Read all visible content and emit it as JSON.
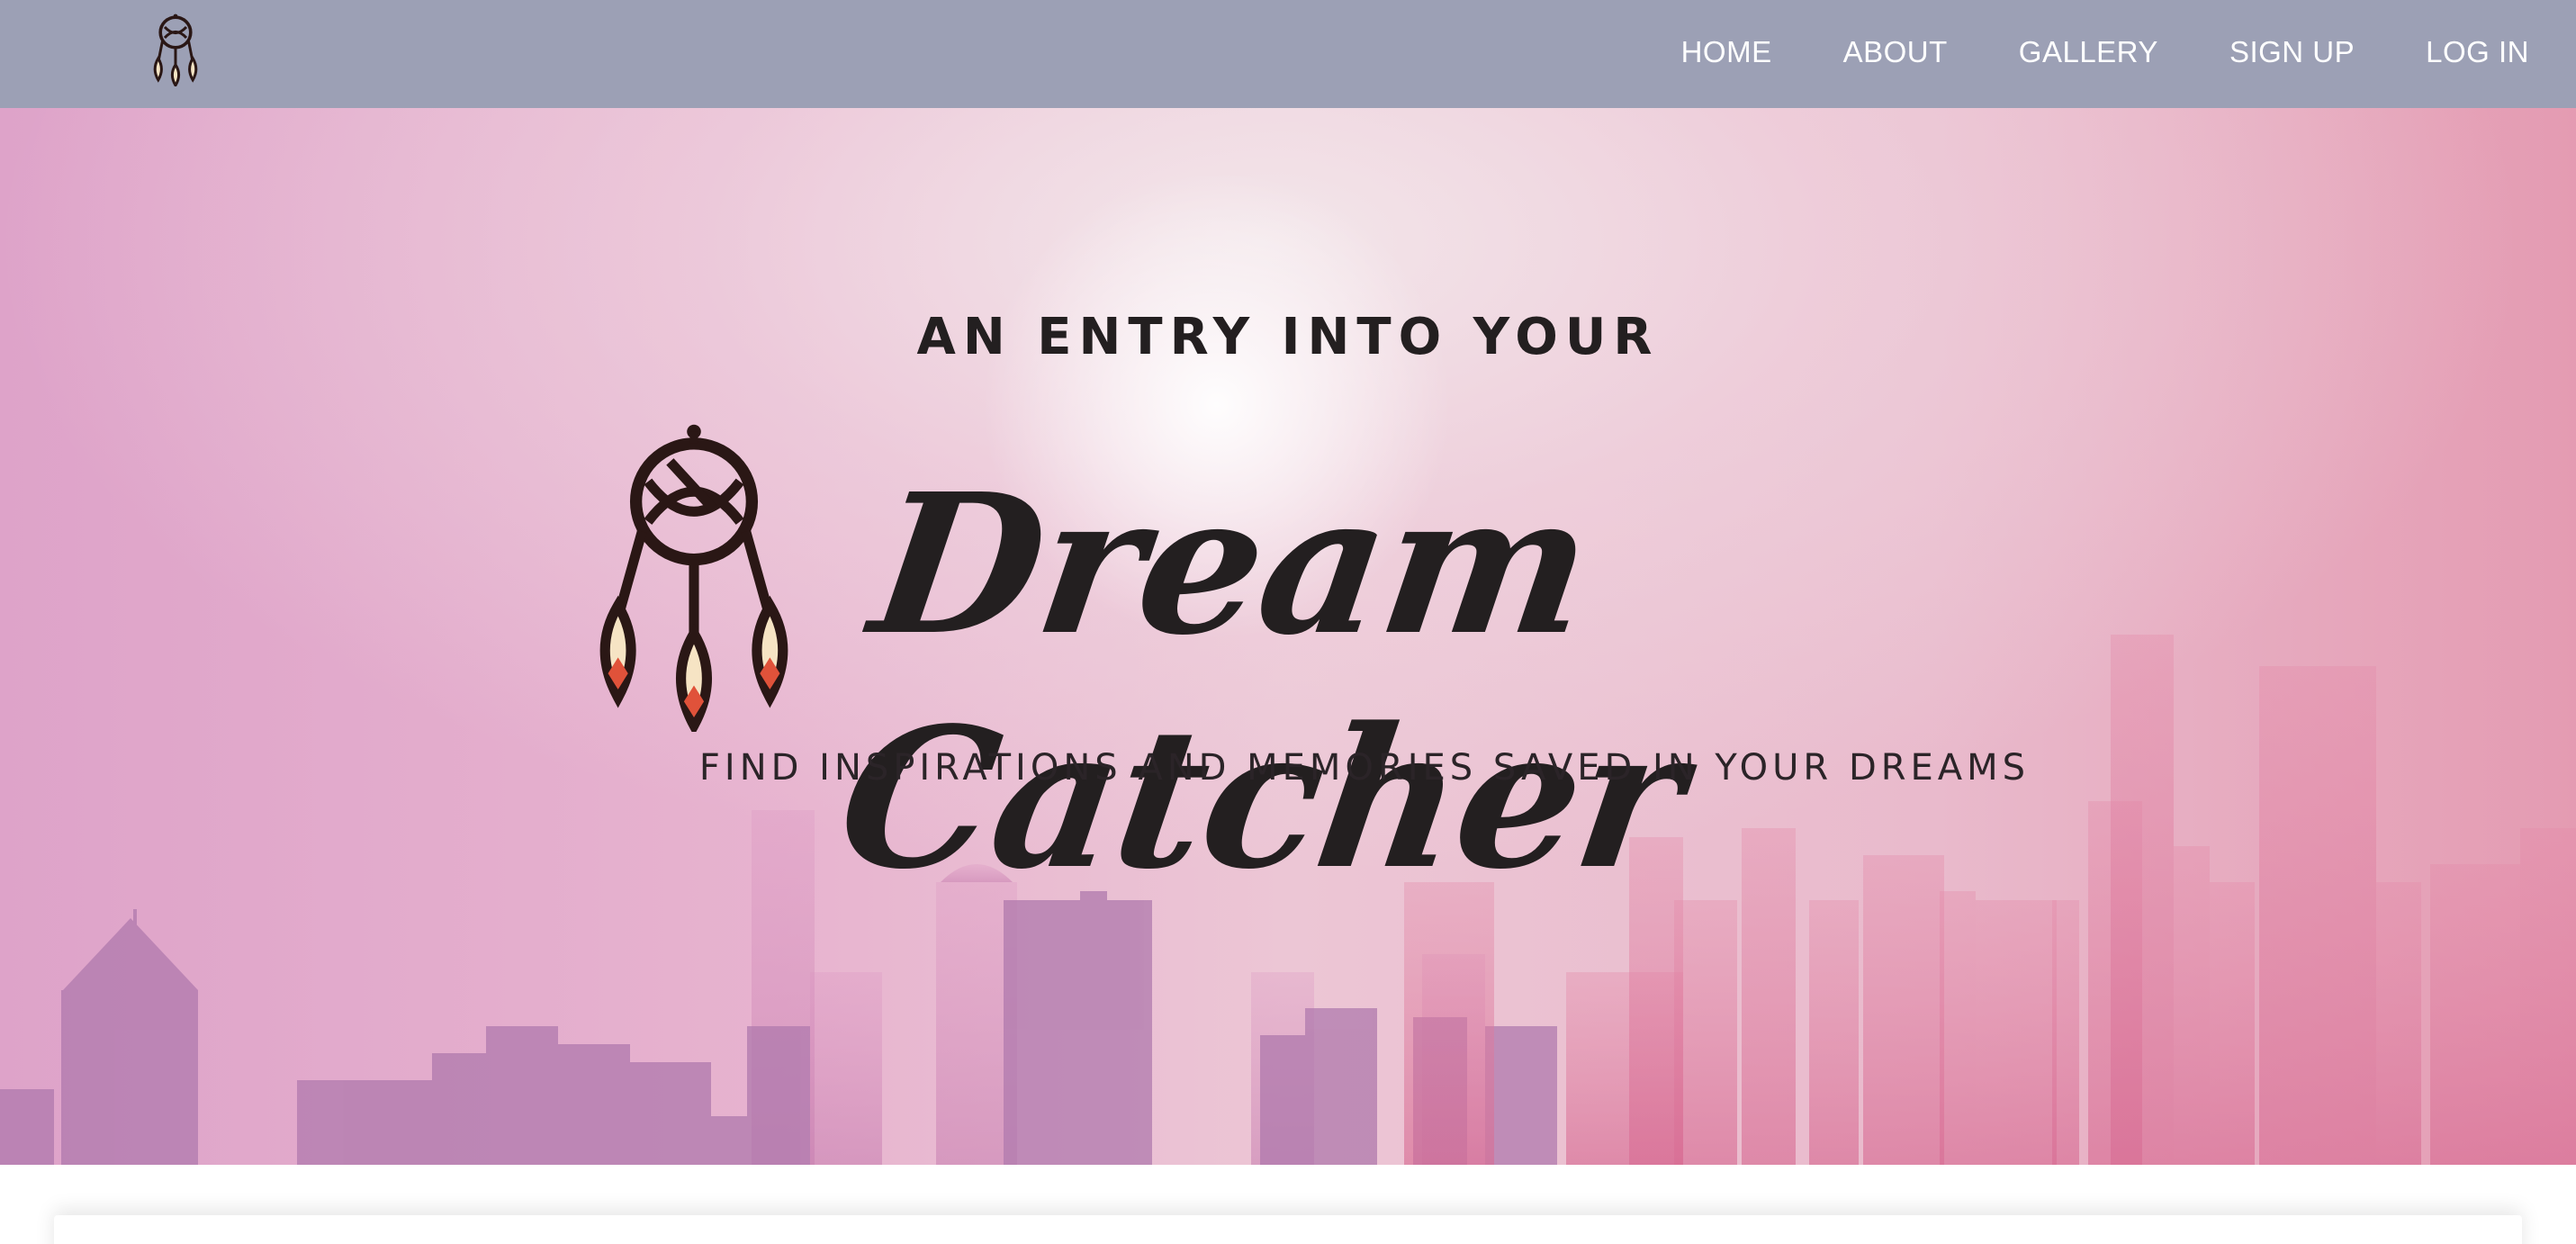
{
  "nav": {
    "logo_icon": "dream-catcher-logo",
    "links": [
      "HOME",
      "ABOUT",
      "GALLERY",
      "SIGN UP",
      "LOG IN"
    ]
  },
  "hero": {
    "pretitle": "AN ENTRY INTO YOUR",
    "title": "Dream Catcher",
    "subtitle": "FIND INSPIRATIONS AND MEMORIES SAVED IN YOUR DREAMS",
    "logo_icon": "dream-catcher-logo",
    "background": "pink-city-skyline"
  },
  "colors": {
    "navbar": "#9ca0b5",
    "text_dark": "#231f20",
    "feather": "#f6e4c4",
    "feather_tip": "#e0523a"
  }
}
